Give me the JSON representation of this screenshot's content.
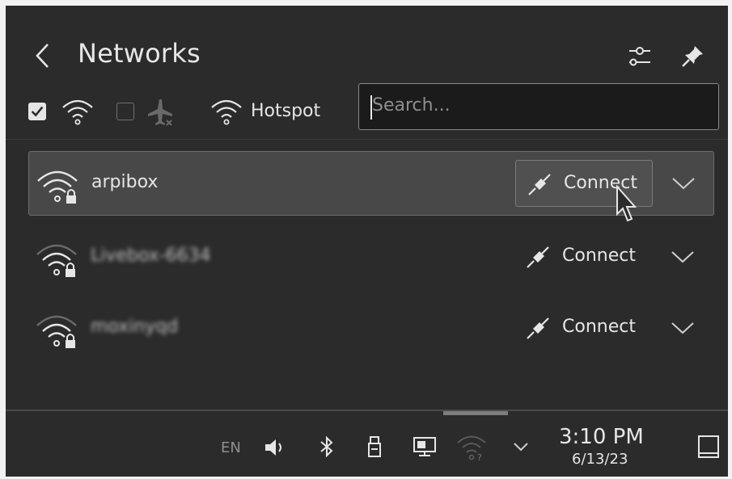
{
  "header": {
    "title": "Networks",
    "back_icon": "chevron-left-icon",
    "configure_icon": "configure-icon",
    "pin_icon": "pin-icon"
  },
  "toolbar": {
    "wifi_enabled": true,
    "wifi_icon": "wifi-icon",
    "airplane_enabled": false,
    "airplane_icon": "airplane-mode-icon",
    "hotspot_label": "Hotspot",
    "hotspot_icon": "wifi-icon"
  },
  "search": {
    "placeholder": "Search...",
    "value": ""
  },
  "networks": [
    {
      "name": "arpibox",
      "action": "Connect",
      "secured": true,
      "signal": 1.0,
      "blurred": false
    },
    {
      "name": "Livebox-6634",
      "action": "Connect",
      "secured": true,
      "signal": 0.75,
      "blurred": true
    },
    {
      "name": "moxinyqd",
      "action": "Connect",
      "secured": true,
      "signal": 0.75,
      "blurred": true
    }
  ],
  "panel": {
    "keyboard_layout": "EN",
    "time": "3:10 PM",
    "date": "6/13/23"
  },
  "colors": {
    "background": "#2b2b2b",
    "selected_row": "#484848",
    "text": "#e6e6e6",
    "muted": "#8e8e8e"
  }
}
